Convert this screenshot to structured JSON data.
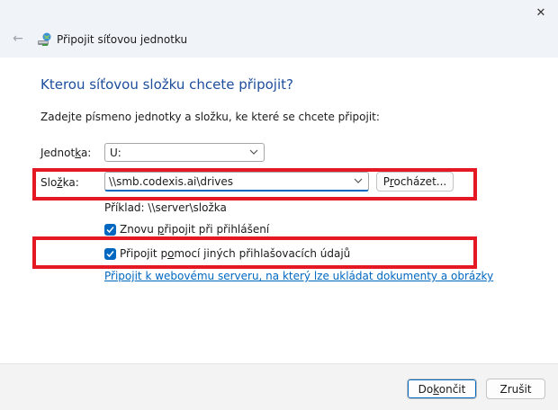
{
  "window": {
    "title": "Připojit síťovou jednotku",
    "close_symbol": "✕",
    "back_symbol": "←"
  },
  "content": {
    "heading": "Kterou síťovou složku chcete připojit?",
    "instruction": "Zadejte písmeno jednotky a složku, ke které se chcete připojit:",
    "drive": {
      "label_pre": "Jednot",
      "label_accel": "k",
      "label_post": "a:",
      "value": "U:"
    },
    "folder": {
      "label_pre": "Slo",
      "label_accel": "ž",
      "label_post": "ka:",
      "value": "\\\\smb.codexis.ai\\drives"
    },
    "browse_button": {
      "pre": "P",
      "accel": "r",
      "post": "ocházet..."
    },
    "example": "Příklad: \\\\server\\složka",
    "reconnect": {
      "checked": true,
      "pre": "Znovu ",
      "accel": "p",
      "post": "řipojit při přihlášení"
    },
    "other_credentials": {
      "checked": true,
      "pre": "Připojit p",
      "accel": "o",
      "post": "mocí jiných přihlašovacích údajů"
    },
    "web_link": "Připojit k webovému serveru, na který lze ukládat dokumenty a obrázky"
  },
  "footer": {
    "finish": {
      "pre": "Do",
      "accel": "k",
      "post": "ončit"
    },
    "cancel": "Zrušit"
  },
  "colors": {
    "accent": "#0067c0",
    "heading": "#1d4e9c",
    "highlight": "#e51923"
  },
  "icons": {
    "window": "network-drive-icon",
    "back": "back-arrow-icon",
    "close": "close-icon",
    "dropdown": "chevron-down-icon",
    "checkbox": "checkmark-icon"
  }
}
